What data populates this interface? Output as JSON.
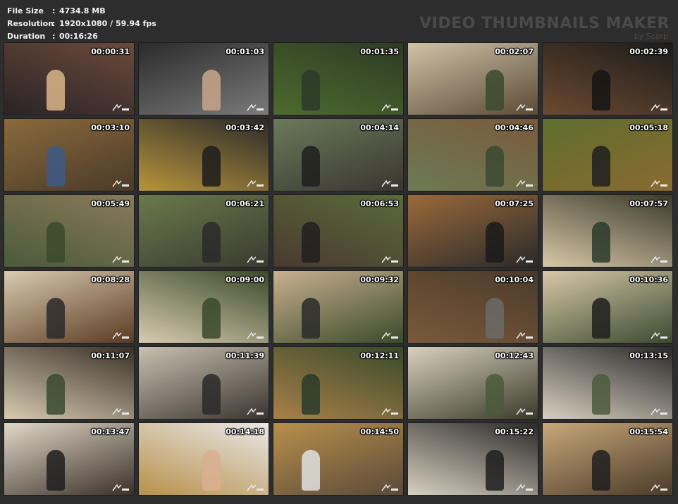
{
  "info": {
    "rows": [
      {
        "key": "File Size",
        "value": "4734.8 MB"
      },
      {
        "key": "Resolution",
        "value": "1920x1080 / 59.94 fps"
      },
      {
        "key": "Duration",
        "value": "00:16:26"
      }
    ],
    "separator": ":"
  },
  "brand": {
    "title": "VIDEO THUMBNAILS MAKER",
    "by": "by Scorp"
  },
  "thumbnails": [
    {
      "time": "00:00:31",
      "bg": [
        "#2a2328",
        "#6b4a3a"
      ],
      "fig": "#d9b68a"
    },
    {
      "time": "00:01:03",
      "bg": [
        "#2b2b2b",
        "#7a7a7a"
      ],
      "fig": "#c9a58a"
    },
    {
      "time": "00:01:35",
      "bg": [
        "#4d6b2e",
        "#2e3a24"
      ],
      "fig": "#2b3a2a"
    },
    {
      "time": "00:02:07",
      "bg": [
        "#cfc3a8",
        "#5b4a36"
      ],
      "fig": "#3a4a2e"
    },
    {
      "time": "00:02:39",
      "bg": [
        "#6b4a30",
        "#1c1c1c"
      ],
      "fig": "#141414"
    },
    {
      "time": "00:03:10",
      "bg": [
        "#8a6a3c",
        "#4a3a28"
      ],
      "fig": "#3d5a86"
    },
    {
      "time": "00:03:42",
      "bg": [
        "#b8943c",
        "#2a2a2a"
      ],
      "fig": "#1c1c1c"
    },
    {
      "time": "00:04:14",
      "bg": [
        "#6a7a5a",
        "#3a3530"
      ],
      "fig": "#1e1e1e"
    },
    {
      "time": "00:04:46",
      "bg": [
        "#6c7a55",
        "#7a5a3c"
      ],
      "fig": "#3a4a30"
    },
    {
      "time": "00:05:18",
      "bg": [
        "#5e6e2e",
        "#8a6a30"
      ],
      "fig": "#1e1e1e"
    },
    {
      "time": "00:05:49",
      "bg": [
        "#4a5a3a",
        "#8a7a5a"
      ],
      "fig": "#3a4a2a"
    },
    {
      "time": "00:06:21",
      "bg": [
        "#6a7a4a",
        "#3a3a30"
      ],
      "fig": "#2a2a2a"
    },
    {
      "time": "00:06:53",
      "bg": [
        "#4a3a30",
        "#5a6a3a"
      ],
      "fig": "#1e1e1e"
    },
    {
      "time": "00:07:25",
      "bg": [
        "#9a6a3a",
        "#2a2a2a"
      ],
      "fig": "#1a1a1a"
    },
    {
      "time": "00:07:57",
      "bg": [
        "#d8c8a8",
        "#3a3a2a"
      ],
      "fig": "#2a3a2a"
    },
    {
      "time": "00:08:28",
      "bg": [
        "#d8cbb0",
        "#5a3a22"
      ],
      "fig": "#2a2a2a"
    },
    {
      "time": "00:09:00",
      "bg": [
        "#d8cbb0",
        "#3a4a2a"
      ],
      "fig": "#3a4a2a"
    },
    {
      "time": "00:09:32",
      "bg": [
        "#c9b090",
        "#3a4a2a"
      ],
      "fig": "#2a2a2a"
    },
    {
      "time": "00:10:04",
      "bg": [
        "#7a5a3a",
        "#4a3a2a"
      ],
      "fig": "#6a6a6a"
    },
    {
      "time": "00:10:36",
      "bg": [
        "#d8c8a8",
        "#3a4a30"
      ],
      "fig": "#1e1e1e"
    },
    {
      "time": "00:11:07",
      "bg": [
        "#d8cbb0",
        "#3a3028"
      ],
      "fig": "#3a4a30"
    },
    {
      "time": "00:11:39",
      "bg": [
        "#c8c0b0",
        "#3a3530"
      ],
      "fig": "#2a2a2a"
    },
    {
      "time": "00:12:11",
      "bg": [
        "#a8804a",
        "#3a4a2a"
      ],
      "fig": "#2a3a2a"
    },
    {
      "time": "00:12:43",
      "bg": [
        "#d8d0c0",
        "#3a3a2a"
      ],
      "fig": "#4a5a3a"
    },
    {
      "time": "00:13:15",
      "bg": [
        "#d8cfc0",
        "#2a2a2a"
      ],
      "fig": "#4a5a3a"
    },
    {
      "time": "00:13:47",
      "bg": [
        "#e0d8c8",
        "#3a3028"
      ],
      "fig": "#1e1e1e"
    },
    {
      "time": "00:14:18",
      "bg": [
        "#b8904a",
        "#e8e8e8"
      ],
      "fig": "#d8b090"
    },
    {
      "time": "00:14:50",
      "bg": [
        "#b8904a",
        "#5a4a3a"
      ],
      "fig": "#e0e0e0"
    },
    {
      "time": "00:15:22",
      "bg": [
        "#d8d0c0",
        "#2a2a2a"
      ],
      "fig": "#1e1e1e"
    },
    {
      "time": "00:15:54",
      "bg": [
        "#c8a878",
        "#4a3a2a"
      ],
      "fig": "#1e1e1e"
    }
  ]
}
